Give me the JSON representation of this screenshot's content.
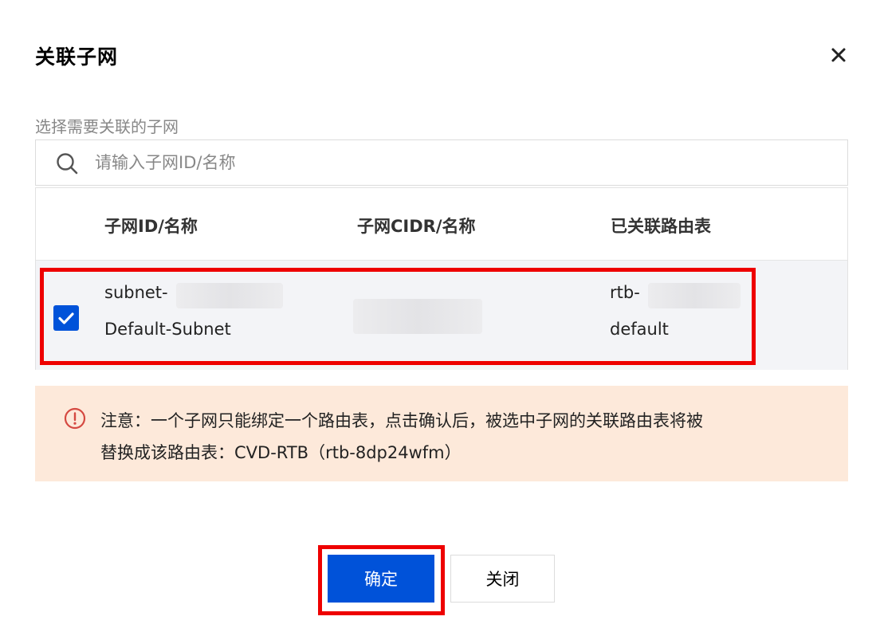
{
  "dialog": {
    "title": "关联子网",
    "close_icon": "close-icon"
  },
  "section_label": "选择需要关联的子网",
  "search": {
    "placeholder": "请输入子网ID/名称",
    "value": "",
    "icon": "search-icon"
  },
  "table": {
    "columns": [
      "子网ID/名称",
      "子网CIDR/名称",
      "已关联路由表"
    ],
    "rows": [
      {
        "checked": true,
        "subnet_id": "subnet-",
        "subnet_name": "Default-Subnet",
        "cidr": "",
        "route_table_id": "rtb-",
        "route_table_name": "default"
      }
    ]
  },
  "notice": {
    "icon": "warning-circle-icon",
    "line1": "注意：一个子网只能绑定一个路由表，点击确认后，被选中子网的关联路由表将被",
    "line2": "替换成该路由表：CVD-RTB（rtb-8dp24wfm）"
  },
  "buttons": {
    "confirm": "确定",
    "close": "关闭"
  },
  "colors": {
    "primary": "#0052d9",
    "notice_bg": "#fde9da",
    "notice_icon": "#d54941",
    "highlight": "#ee0000",
    "selected_row_bg": "#f3f4f7"
  }
}
